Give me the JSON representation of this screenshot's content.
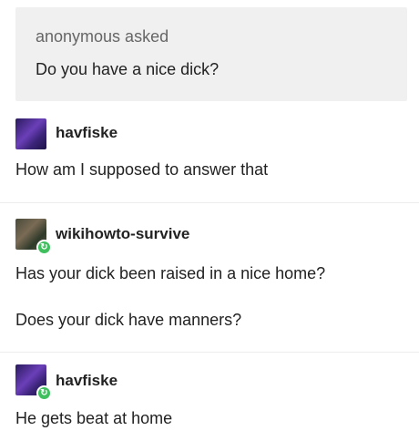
{
  "ask": {
    "asker": "anonymous asked",
    "question": "Do you have a nice dick?"
  },
  "posts": [
    {
      "username": "havfiske",
      "lines": [
        "How am I supposed to answer that"
      ],
      "avatar": "purple-avatar",
      "reblogged": false
    },
    {
      "username": "wikihowto-survive",
      "lines": [
        "Has your dick been raised in a nice home?",
        "Does your dick have manners?"
      ],
      "avatar": "dark-avatar",
      "reblogged": true
    },
    {
      "username": "havfiske",
      "lines": [
        "He gets beat at home"
      ],
      "avatar": "purple-avatar",
      "reblogged": true
    }
  ],
  "icons": {
    "reblog": "reblog-icon"
  },
  "colors": {
    "ask_background": "#f0f0f0",
    "reblog_badge": "#3fbf5e"
  }
}
